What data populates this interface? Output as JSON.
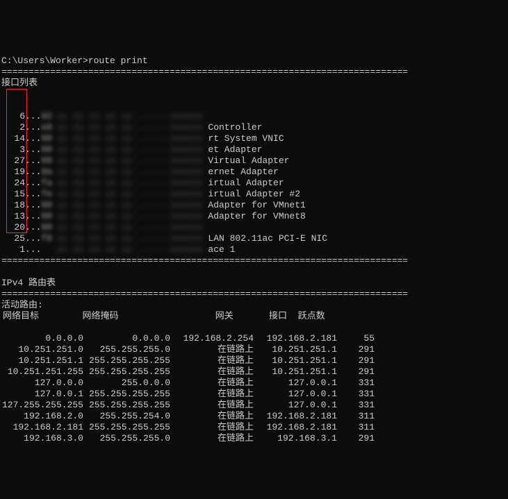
{
  "prompt": "C:\\Users\\Worker>route print",
  "divider": "===========================================================================",
  "section_iface": "接口列表",
  "interfaces": [
    {
      "num": "6",
      "hex": "02",
      "desc": ""
    },
    {
      "num": "2",
      "hex": "e8",
      "desc": "Controller"
    },
    {
      "num": "14",
      "hex": "00",
      "desc": "rt System VNIC"
    },
    {
      "num": "3",
      "hex": "00",
      "desc": "et Adapter"
    },
    {
      "num": "27",
      "hex": "00",
      "desc": "Virtual Adapter"
    },
    {
      "num": "19",
      "hex": "0a",
      "desc": "ernet Adapter"
    },
    {
      "num": "24",
      "hex": "fa",
      "desc": "irtual Adapter"
    },
    {
      "num": "15",
      "hex": "fe",
      "desc": "irtual Adapter #2"
    },
    {
      "num": "18",
      "hex": "00",
      "desc": "Adapter for VMnet1"
    },
    {
      "num": "13",
      "hex": "00",
      "desc": "Adapter for VMnet8"
    },
    {
      "num": "20",
      "hex": "00",
      "desc": ""
    },
    {
      "num": "25",
      "hex": "f8",
      "desc": "LAN 802.11ac PCI-E NIC"
    },
    {
      "num": "1",
      "hex": "",
      "desc": "ace 1"
    }
  ],
  "ipv4_title": "IPv4 路由表",
  "active_title": "活动路由:",
  "headers": {
    "dest": "网络目标",
    "mask": "网络掩码",
    "gw": "网关",
    "iface": "接口",
    "metric": "跃点数"
  },
  "chart_data": {
    "type": "table",
    "columns": [
      "网络目标",
      "网络掩码",
      "网关",
      "接口",
      "跃点数"
    ],
    "rows": [
      [
        "0.0.0.0",
        "0.0.0.0",
        "192.168.2.254",
        "192.168.2.181",
        "55"
      ],
      [
        "10.251.251.0",
        "255.255.255.0",
        "在链路上",
        "10.251.251.1",
        "291"
      ],
      [
        "10.251.251.1",
        "255.255.255.255",
        "在链路上",
        "10.251.251.1",
        "291"
      ],
      [
        "10.251.251.255",
        "255.255.255.255",
        "在链路上",
        "10.251.251.1",
        "291"
      ],
      [
        "127.0.0.0",
        "255.0.0.0",
        "在链路上",
        "127.0.0.1",
        "331"
      ],
      [
        "127.0.0.1",
        "255.255.255.255",
        "在链路上",
        "127.0.0.1",
        "331"
      ],
      [
        "127.255.255.255",
        "255.255.255.255",
        "在链路上",
        "127.0.0.1",
        "331"
      ],
      [
        "192.168.2.0",
        "255.255.254.0",
        "在链路上",
        "192.168.2.181",
        "311"
      ],
      [
        "192.168.2.181",
        "255.255.255.255",
        "在链路上",
        "192.168.2.181",
        "311"
      ],
      [
        "192.168.3.0",
        "255.255.255.0",
        "在链路上",
        "192.168.3.1",
        "291"
      ]
    ]
  }
}
